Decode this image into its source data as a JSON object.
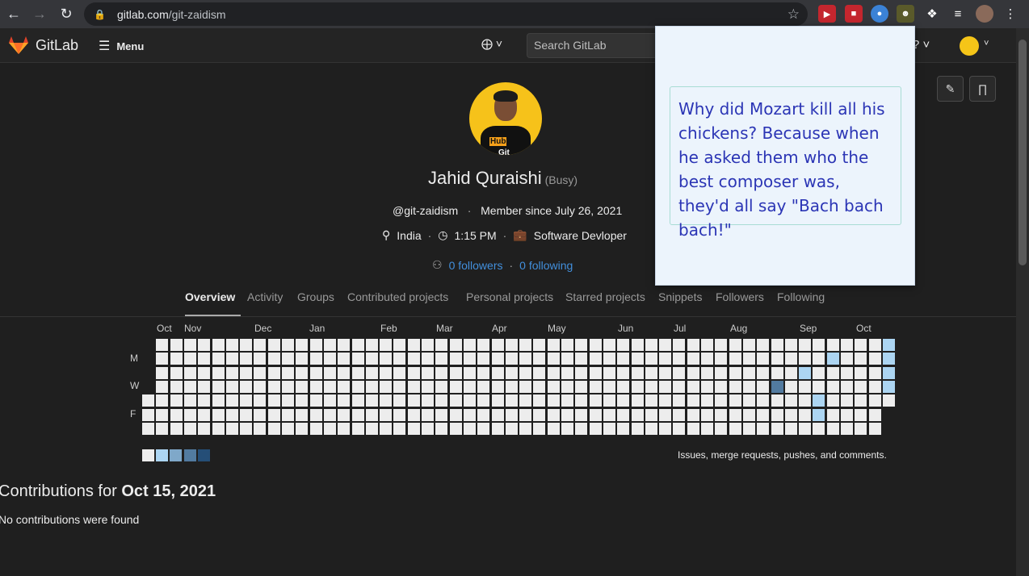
{
  "browser": {
    "url_domain": "gitlab.com",
    "url_path": "/git-zaidism"
  },
  "header": {
    "brand": "GitLab",
    "menu_label": "Menu",
    "search_placeholder": "Search GitLab"
  },
  "profile": {
    "name": "Jahid Quraishi",
    "status": "(Busy)",
    "username": "@git-zaidism",
    "member_since": "Member since July 26, 2021",
    "location": "India",
    "local_time": "1:15 PM",
    "job_title": "Software Devloper",
    "followers": "0 followers",
    "following": "0 following",
    "avatar_shirt_a": "Git",
    "avatar_shirt_b": "Hub"
  },
  "tabs": [
    "Overview",
    "Activity",
    "Groups",
    "Contributed projects",
    "Personal projects",
    "Starred projects",
    "Snippets",
    "Followers",
    "Following"
  ],
  "calendar": {
    "months": [
      "Oct",
      "Nov",
      "Dec",
      "Jan",
      "Feb",
      "Mar",
      "Apr",
      "May",
      "Jun",
      "Jul",
      "Aug",
      "Sep",
      "Oct"
    ],
    "day_labels": [
      "M",
      "W",
      "F"
    ],
    "legend_text": "Issues, merge requests, pushes, and comments.",
    "colors": [
      "#ededed",
      "#acd5f2",
      "#7fa8c9",
      "#527ba0",
      "#254e77"
    ]
  },
  "contributions": {
    "title_prefix": "Contributions for",
    "date": "Oct 15, 2021",
    "empty": "No contributions were found"
  },
  "popup": {
    "joke": "Why did Mozart kill all his chickens? Because when he asked them who the best composer was, they'd all say \"Bach bach bach!\""
  }
}
